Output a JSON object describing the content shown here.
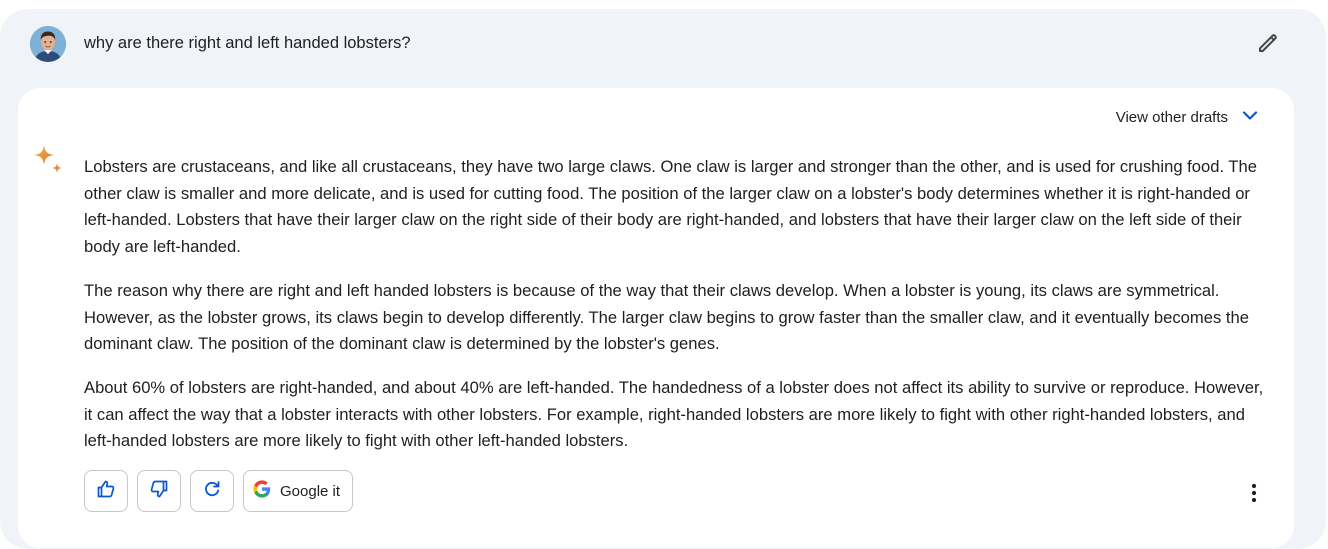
{
  "prompt": {
    "text": "why are there right and left handed lobsters?"
  },
  "drafts": {
    "label": "View other drafts"
  },
  "response": {
    "paragraphs": [
      "Lobsters are crustaceans, and like all crustaceans, they have two large claws. One claw is larger and stronger than the other, and is used for crushing food. The other claw is smaller and more delicate, and is used for cutting food. The position of the larger claw on a lobster's body determines whether it is right-handed or left-handed. Lobsters that have their larger claw on the right side of their body are right-handed, and lobsters that have their larger claw on the left side of their body are left-handed.",
      "The reason why there are right and left handed lobsters is because of the way that their claws develop. When a lobster is young, its claws are symmetrical. However, as the lobster grows, its claws begin to develop differently. The larger claw begins to grow faster than the smaller claw, and it eventually becomes the dominant claw. The position of the dominant claw is determined by the lobster's genes.",
      "About 60% of lobsters are right-handed, and about 40% are left-handed. The handedness of a lobster does not affect its ability to survive or reproduce. However, it can affect the way that a lobster interacts with other lobsters. For example, right-handed lobsters are more likely to fight with other right-handed lobsters, and left-handed lobsters are more likely to fight with other left-handed lobsters."
    ]
  },
  "actions": {
    "google_label": "Google it"
  },
  "icons": {
    "avatar": "user-avatar",
    "edit": "pencil-icon",
    "drafts_toggle": "chevron-down-icon",
    "assistant": "sparkle-icon",
    "like": "thumbs-up-icon",
    "dislike": "thumbs-down-icon",
    "regenerate": "refresh-icon",
    "google": "google-g-icon",
    "more": "more-vertical-icon"
  },
  "colors": {
    "page_bg": "#f0f4f9",
    "card_bg": "#ffffff",
    "accent_blue": "#0b57d0",
    "text": "#1f1f1f"
  }
}
